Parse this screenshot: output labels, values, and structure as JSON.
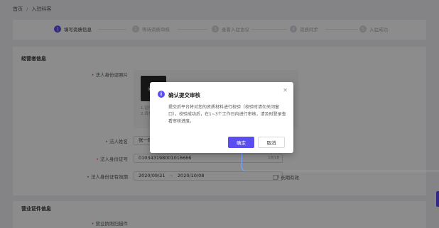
{
  "breadcrumb": {
    "home": "首页",
    "separator": "/",
    "current": "入驻科客"
  },
  "steps": [
    {
      "num": "1",
      "label": "填写资质信息",
      "active": true
    },
    {
      "num": "2",
      "label": "等待资质审核",
      "active": false
    },
    {
      "num": "3",
      "label": "查看入驻协议",
      "active": false
    },
    {
      "num": "4",
      "label": "资质同步",
      "active": false
    },
    {
      "num": "5",
      "label": "入驻成功",
      "active": false
    }
  ],
  "operator_section": {
    "title": "经营者信息",
    "id_photo_label": "法人身份证照片",
    "upload_tip_1": "1.证件照片...",
    "upload_tip_2": "2.请参考页...",
    "name_label": "法人姓名",
    "name_value": "张一鸣",
    "id_number_label": "法人身份证号",
    "id_number_value": "010343198001016666",
    "id_number_counter": "18/18",
    "validity_label": "法人身份证有效期",
    "validity_start": "2020/09/21",
    "validity_separator": "~",
    "validity_end": "2020/10/08",
    "long_term_label": "长期有效"
  },
  "business_section": {
    "title": "营业证件信息",
    "license_label": "营业执照扫描件"
  },
  "dialog": {
    "title": "确认提交审核",
    "body": "提交后平台将对您的资质材料进行校验（校验时请勿关闭窗口），校验成功后，在1~3个工作日内进行审核，请及时登录查看审核进度。",
    "confirm_label": "确定",
    "cancel_label": "取消",
    "close_icon": "close-icon",
    "info_icon": "info-icon"
  },
  "colors": {
    "primary": "#5b4ef0",
    "required": "#e34d59",
    "connector": "#7ea6ff"
  }
}
